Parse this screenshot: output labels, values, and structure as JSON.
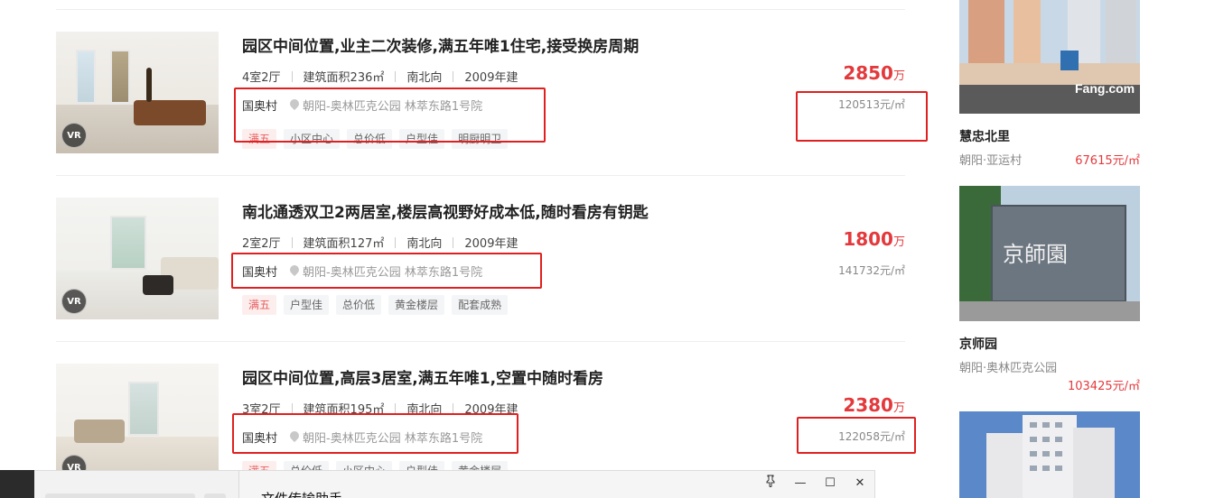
{
  "listings": [
    {
      "title": "园区中间位置,业主二次装修,满五年唯1住宅,接受换房周期",
      "layout": "4室2厅",
      "area": "建筑面积236㎡",
      "orientation": "南北向",
      "built": "2009年建",
      "community": "国奥村",
      "address": "朝阳-奥林匹克公园 林萃东路1号院",
      "tags": [
        "满五",
        "小区中心",
        "总价低",
        "户型佳",
        "明厨明卫"
      ],
      "price": "2850",
      "price_unit": "万",
      "unit_price": "120513元/㎡",
      "vr": "VR"
    },
    {
      "title": "南北通透双卫2两居室,楼层高视野好成本低,随时看房有钥匙",
      "layout": "2室2厅",
      "area": "建筑面积127㎡",
      "orientation": "南北向",
      "built": "2009年建",
      "community": "国奥村",
      "address": "朝阳-奥林匹克公园 林萃东路1号院",
      "tags": [
        "满五",
        "户型佳",
        "总价低",
        "黄金楼层",
        "配套成熟"
      ],
      "price": "1800",
      "price_unit": "万",
      "unit_price": "141732元/㎡",
      "vr": "VR"
    },
    {
      "title": "园区中间位置,高层3居室,满五年唯1,空置中随时看房",
      "layout": "3室2厅",
      "area": "建筑面积195㎡",
      "orientation": "南北向",
      "built": "2009年建",
      "community": "国奥村",
      "address": "朝阳-奥林匹克公园 林萃东路1号院",
      "tags": [
        "满五",
        "总价低",
        "小区中心",
        "户型佳",
        "黄金楼层"
      ],
      "price": "2380",
      "price_unit": "万",
      "unit_price": "122058元/㎡",
      "vr": "VR"
    }
  ],
  "sidebar": [
    {
      "name": "慧忠北里",
      "area": "朝阳·亚运村",
      "price": "67615元/㎡",
      "watermark": "Fang.com"
    },
    {
      "name": "京师园",
      "area": "朝阳·奥林匹克公园",
      "price": "103425元/㎡",
      "sign": "京師園"
    },
    {
      "name": "",
      "area": "",
      "price": ""
    }
  ],
  "chat": {
    "title": "文件传输助手",
    "pin_icon": "pin-icon",
    "minimize": "—",
    "maximize": "☐",
    "close": "✕"
  },
  "colors": {
    "accent": "#e4393c",
    "highlight_box": "#e02020",
    "hot_tag_bg": "#fdeeee"
  }
}
